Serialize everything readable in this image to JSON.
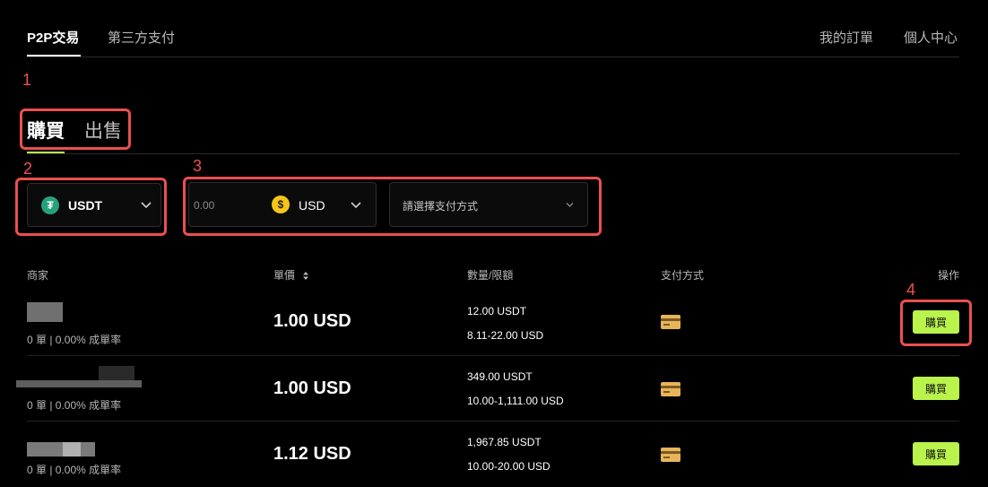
{
  "nav": {
    "tabs": [
      "P2P交易",
      "第三方支付"
    ],
    "right": [
      "我的訂單",
      "個人中心"
    ]
  },
  "annotations": [
    "1",
    "2",
    "3",
    "4"
  ],
  "side_tabs": [
    "購買",
    "出售"
  ],
  "filters": {
    "coin": "USDT",
    "amount_placeholder": "0.00",
    "fiat": "USD",
    "payment_placeholder": "請選擇支付方式"
  },
  "table": {
    "headers": [
      "商家",
      "單價",
      "數量/限額",
      "支付方式",
      "操作"
    ],
    "rows": [
      {
        "stats": "0 單 | 0.00% 成單率",
        "price": "1.00 USD",
        "quantity": "12.00 USDT",
        "limit": "8.11-22.00 USD",
        "action": "購買"
      },
      {
        "stats": "0 單 | 0.00% 成單率",
        "price": "1.00 USD",
        "quantity": "349.00 USDT",
        "limit": "10.00-1,111.00 USD",
        "action": "購買"
      },
      {
        "stats": "0 單 | 0.00% 成單率",
        "price": "1.12 USD",
        "quantity": "1,967.85 USDT",
        "limit": "10.00-20.00 USD",
        "action": "購買"
      }
    ]
  },
  "colors": {
    "accent": "#b9f34b",
    "annotation": "#e9504f",
    "usdt": "#26a17b",
    "usd": "#f5c518",
    "card": "#e8b45a"
  }
}
